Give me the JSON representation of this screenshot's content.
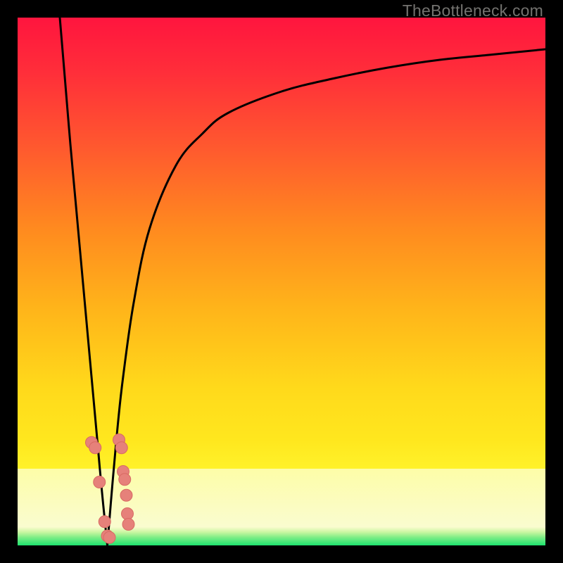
{
  "watermark": "TheBottleneck.com",
  "colors": {
    "frame": "#000000",
    "curve": "#000000",
    "dot_fill": "#e6817a",
    "dot_stroke": "#d86a63",
    "green": "#1ee36f",
    "red_top": "#ff153e",
    "orange": "#ff8a1f",
    "yellow": "#ffe71e",
    "pale_yellow": "#fdfda8"
  },
  "chart_data": {
    "type": "line",
    "title": "",
    "xlabel": "",
    "ylabel": "",
    "xlim": [
      0,
      100
    ],
    "ylim": [
      0,
      100
    ],
    "x_optimum": 17,
    "series": [
      {
        "name": "left-branch",
        "x": [
          8,
          9,
          10,
          11,
          12,
          13,
          14,
          15,
          16,
          17
        ],
        "y": [
          100,
          88,
          76,
          65,
          54,
          43,
          32,
          21,
          10,
          0
        ]
      },
      {
        "name": "right-branch",
        "x": [
          17,
          18,
          19,
          20,
          22,
          25,
          30,
          35,
          40,
          50,
          60,
          70,
          80,
          90,
          100
        ],
        "y": [
          0,
          12,
          23,
          32,
          46,
          60,
          72,
          78,
          82,
          86,
          88.5,
          90.5,
          92,
          93,
          94
        ]
      }
    ],
    "dots_left": [
      {
        "x": 14.0,
        "y": 19.5
      },
      {
        "x": 14.7,
        "y": 18.5
      },
      {
        "x": 15.5,
        "y": 12.0
      },
      {
        "x": 16.5,
        "y": 4.5
      },
      {
        "x": 17.0,
        "y": 1.8
      },
      {
        "x": 17.4,
        "y": 1.5
      }
    ],
    "dots_right": [
      {
        "x": 19.2,
        "y": 20.0
      },
      {
        "x": 19.7,
        "y": 18.5
      },
      {
        "x": 20.0,
        "y": 14.0
      },
      {
        "x": 20.3,
        "y": 12.5
      },
      {
        "x": 20.6,
        "y": 9.5
      },
      {
        "x": 20.8,
        "y": 6.0
      },
      {
        "x": 21.0,
        "y": 4.0
      }
    ]
  }
}
